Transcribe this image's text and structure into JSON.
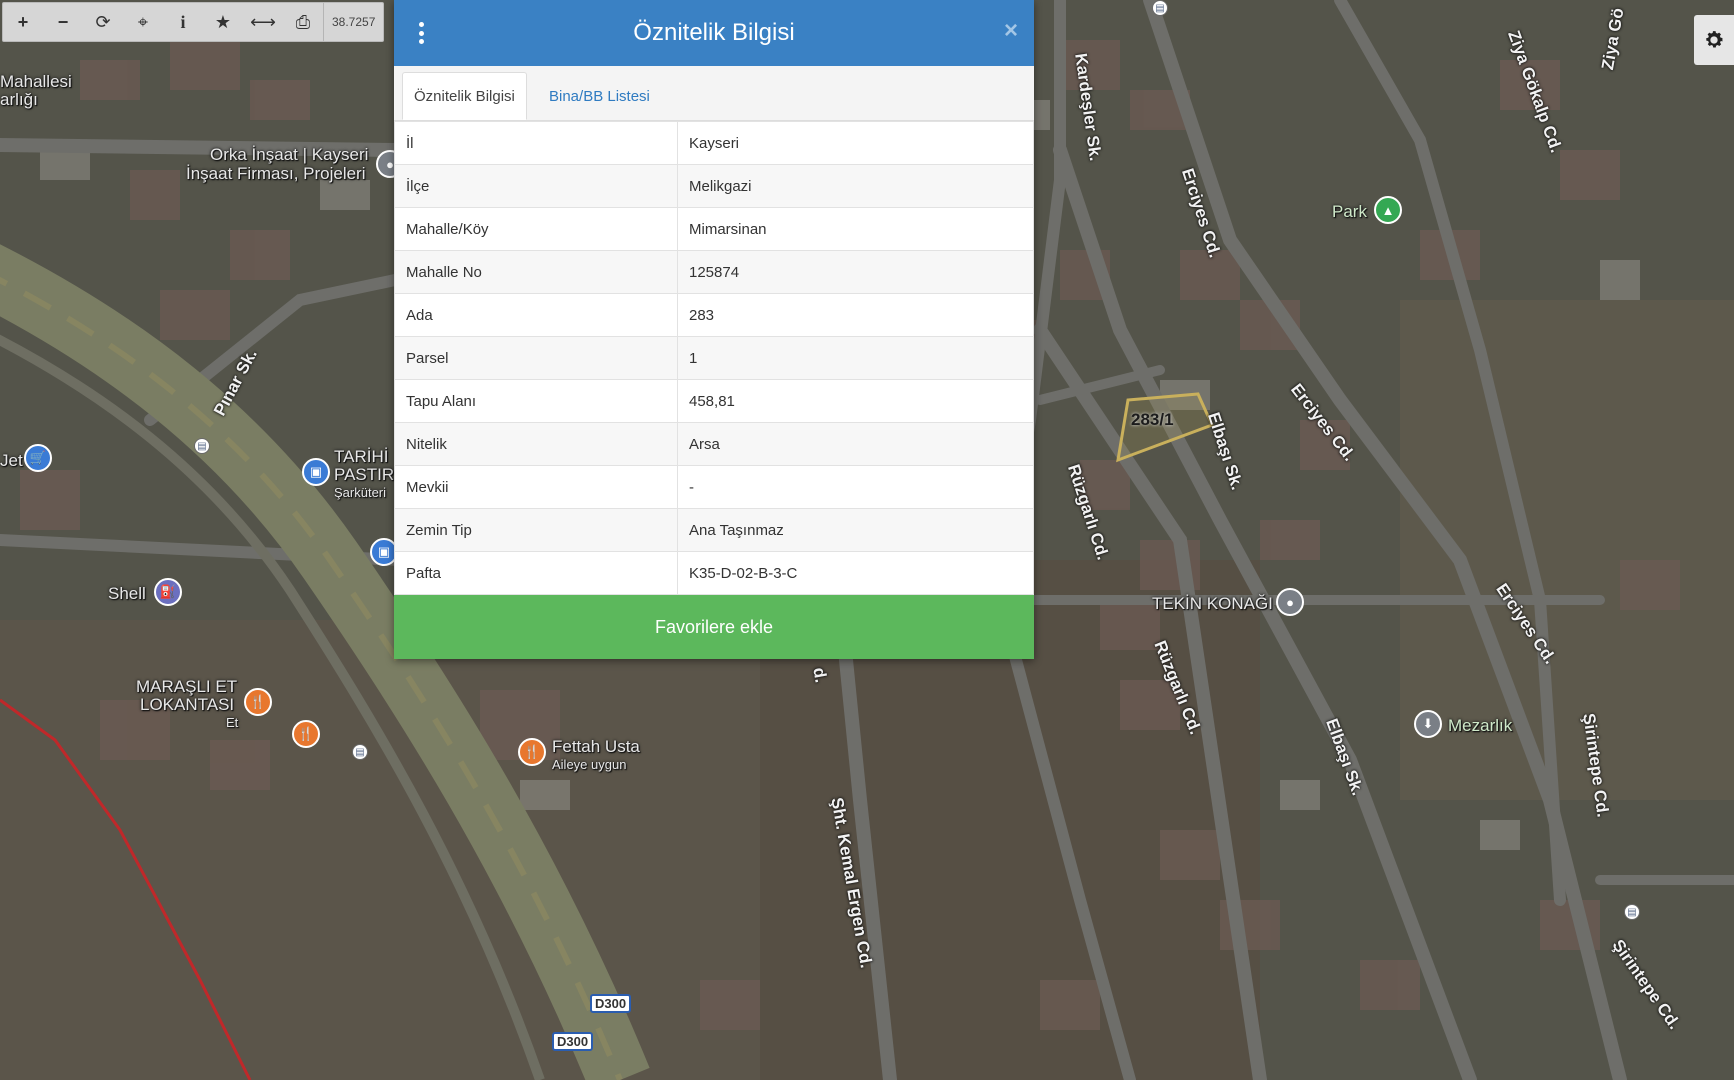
{
  "toolbar": {
    "coordinate": "38.7257",
    "buttons": [
      {
        "icon": "plus-icon",
        "glyph": "+"
      },
      {
        "icon": "minus-icon",
        "glyph": "−"
      },
      {
        "icon": "refresh-icon",
        "glyph": "⟳"
      },
      {
        "icon": "crosshair-icon",
        "glyph": "⌖"
      },
      {
        "icon": "info-icon",
        "glyph": "i"
      },
      {
        "icon": "star-icon",
        "glyph": "★"
      },
      {
        "icon": "measure-icon",
        "glyph": "⟷"
      },
      {
        "icon": "print-icon",
        "glyph": "⎙"
      }
    ]
  },
  "dialog": {
    "title": "Öznitelik Bilgisi",
    "close_glyph": "×",
    "tabs": [
      {
        "label": "Öznitelik Bilgisi",
        "active": true
      },
      {
        "label": "Bina/BB Listesi",
        "active": false
      }
    ],
    "rows": [
      {
        "key": "İl",
        "value": "Kayseri"
      },
      {
        "key": "İlçe",
        "value": "Melikgazi"
      },
      {
        "key": "Mahalle/Köy",
        "value": "Mimarsinan"
      },
      {
        "key": "Mahalle No",
        "value": "125874"
      },
      {
        "key": "Ada",
        "value": "283"
      },
      {
        "key": "Parsel",
        "value": "1"
      },
      {
        "key": "Tapu Alanı",
        "value": "458,81"
      },
      {
        "key": "Nitelik",
        "value": "Arsa"
      },
      {
        "key": "Mevkii",
        "value": "-"
      },
      {
        "key": "Zemin Tip",
        "value": "Ana Taşınmaz"
      },
      {
        "key": "Pafta",
        "value": "K35-D-02-B-3-C"
      }
    ],
    "favorite_button": "Favorilere ekle"
  },
  "map": {
    "parcel_label": "283/1",
    "labels": {
      "mahallesi": "Mahallesi",
      "arligi": "arlığı",
      "orka1": "Orka İnşaat | Kayseri",
      "orka2": "İnşaat Firması, Projeleri",
      "pinar": "Pınar Sk.",
      "tarihi": "TARİHİ",
      "pastir": "PASTIR",
      "sarkuteri": "Şarküteri",
      "et_market": "Jet",
      "shell": "Shell",
      "marasli1": "MARAŞLI ET",
      "marasli2": "LOKANTASI",
      "marasli3": "Et",
      "fettah1": "Fettah Usta",
      "fettah2": "Aileye uygun",
      "kardesler": "Kardeşler Sk.",
      "erciyes1": "Erciyes Cd.",
      "erciyes2": "Erciyes Cd.",
      "erciyes3": "Erciyes Cd.",
      "ziya1": "Ziya Gökalp Cd.",
      "ziya2": "Ziya Gö",
      "park": "Park",
      "elbasi1": "Elbaşı Sk.",
      "elbasi2": "Elbaşı Sk.",
      "ruzgarli1": "Rüzgarlı Cd.",
      "ruzgarli2": "Rüzgarlı Cd.",
      "tekin": "TEKİN KONAĞI",
      "mezarlik": "Mezarlık",
      "sirintepe1": "Şirintepe Cd.",
      "sirintepe2": "Şirintepe Cd.",
      "sht": "Şht. Kemal Ergen Cd.",
      "d_frag": "d.",
      "d300a": "D300",
      "d300b": "D300"
    }
  }
}
